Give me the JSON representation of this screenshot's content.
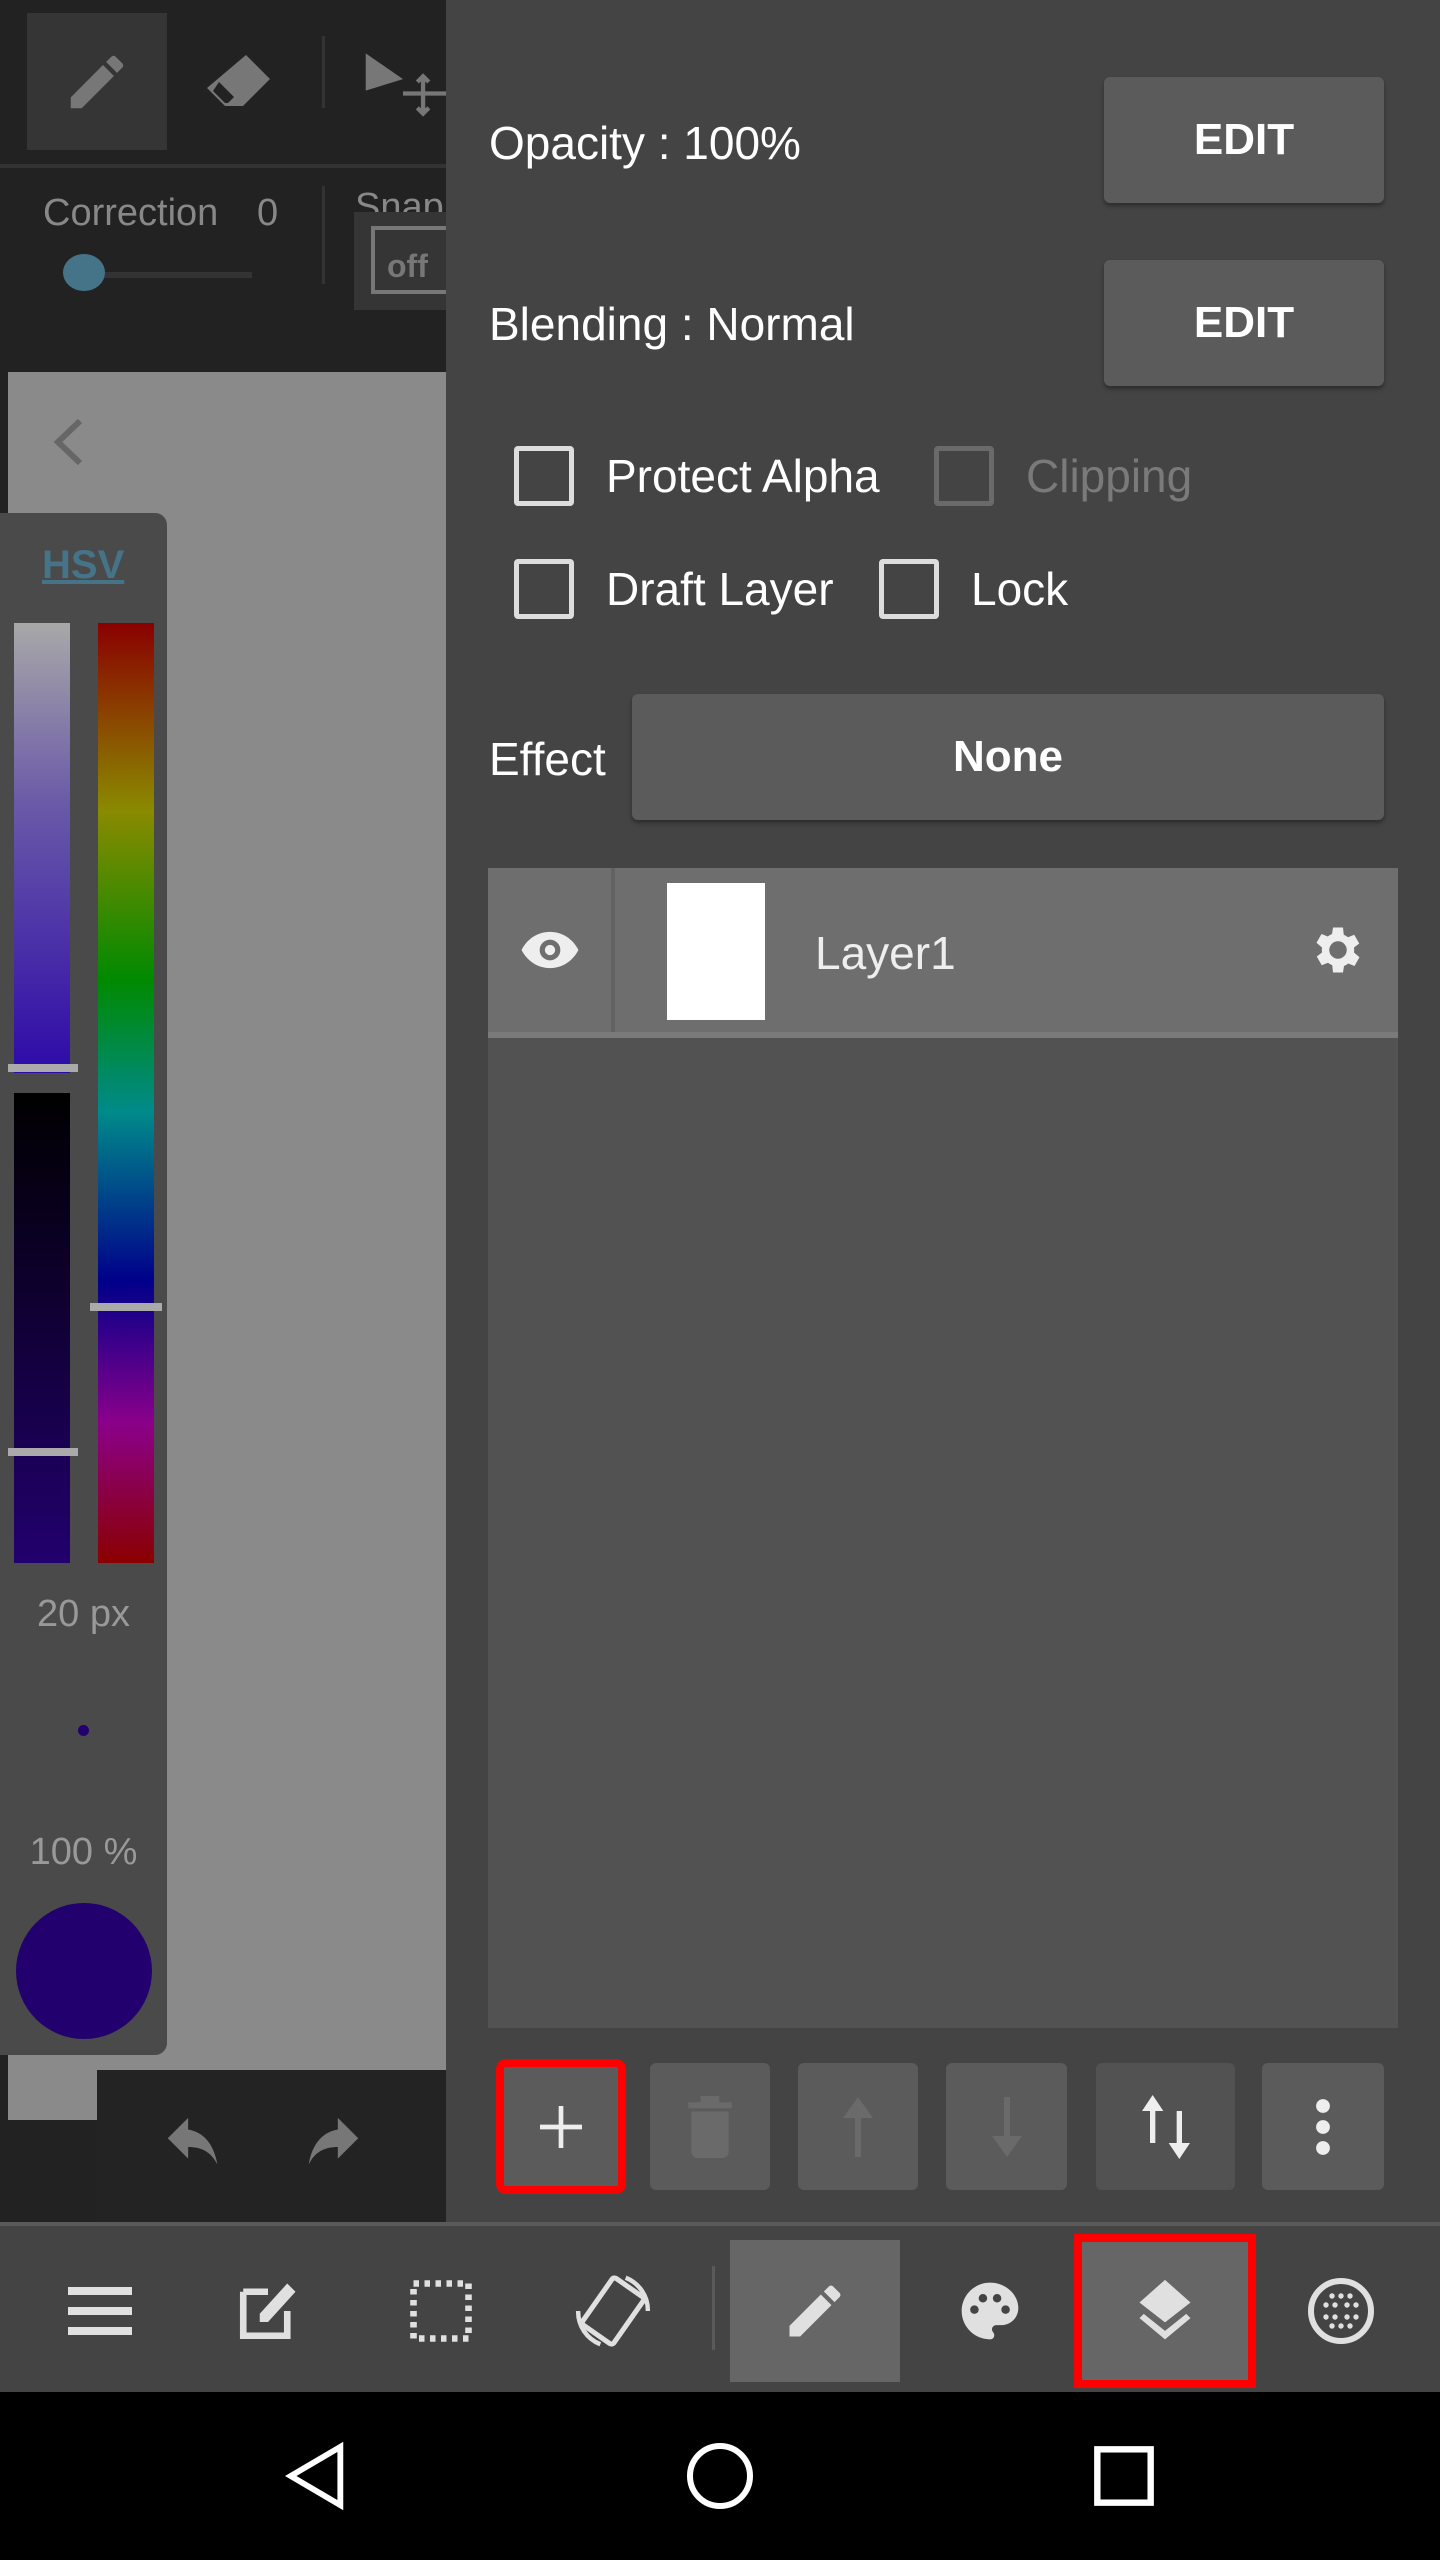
{
  "toolbar": {
    "tools": [
      "pencil-icon",
      "eraser-icon",
      "move-select-icon"
    ]
  },
  "correction": {
    "label": "Correction",
    "value": "0",
    "slider_fraction": 0
  },
  "snap": {
    "label": "Snap",
    "state": "off"
  },
  "color_panel": {
    "mode": "HSV",
    "brush_size": "20 px",
    "opacity": "100 %",
    "current_color": "#22006e"
  },
  "layer_props": {
    "opacity_label": "Opacity : 100%",
    "opacity_edit": "EDIT",
    "blending_label": "Blending : Normal",
    "blending_edit": "EDIT",
    "checkboxes": [
      {
        "label": "Protect Alpha",
        "checked": false,
        "enabled": true
      },
      {
        "label": "Clipping",
        "checked": false,
        "enabled": false
      },
      {
        "label": "Draft Layer",
        "checked": false,
        "enabled": true
      },
      {
        "label": "Lock",
        "checked": false,
        "enabled": true
      }
    ],
    "effect_label": "Effect",
    "effect_value": "None"
  },
  "layers": [
    {
      "name": "Layer1",
      "visible": true
    }
  ],
  "layer_buttons": [
    "add-layer",
    "delete-layer",
    "move-up",
    "move-down",
    "reorder",
    "more"
  ],
  "bottom_nav": [
    "menu",
    "edit",
    "selection",
    "rotate",
    "pencil",
    "palette",
    "layers",
    "materials"
  ],
  "highlight_color": "#ff0000"
}
